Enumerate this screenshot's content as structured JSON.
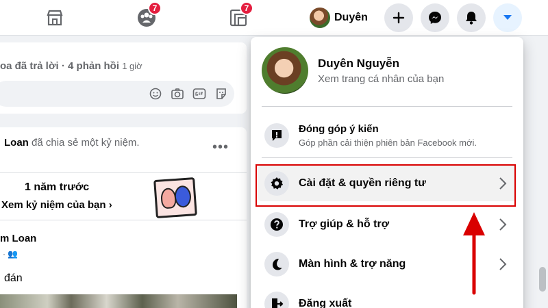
{
  "topbar": {
    "badges": {
      "groups": "7",
      "gaming": "7"
    },
    "profile_name": "Duyên"
  },
  "feed": {
    "reply_meta": "oa đã trả lời · 4 phản hồi",
    "reply_time": "1 giờ",
    "post_author": "Loan",
    "post_action": " đã chia sẻ một kỷ niệm.",
    "memory_title": "1 năm trước",
    "memory_sub": "Xem kỷ niệm của bạn",
    "post_name": "m Loan",
    "post_text": "đán"
  },
  "dropdown": {
    "name": "Duyên Nguyễn",
    "profile_link": "Xem trang cá nhân của bạn",
    "feedback_title": "Đóng góp ý kiến",
    "feedback_sub": "Góp phần cải thiện phiên bản Facebook mới.",
    "items": [
      {
        "label": "Cài đặt & quyền riêng tư",
        "icon": "gear-icon"
      },
      {
        "label": "Trợ giúp & hỗ trợ",
        "icon": "question-icon"
      },
      {
        "label": "Màn hình & trợ năng",
        "icon": "moon-icon"
      },
      {
        "label": "Đăng xuất",
        "icon": "logout-icon"
      }
    ]
  },
  "colors": {
    "accent": "#1877f2",
    "badge": "#e41e3f",
    "annotation": "#d90000"
  }
}
